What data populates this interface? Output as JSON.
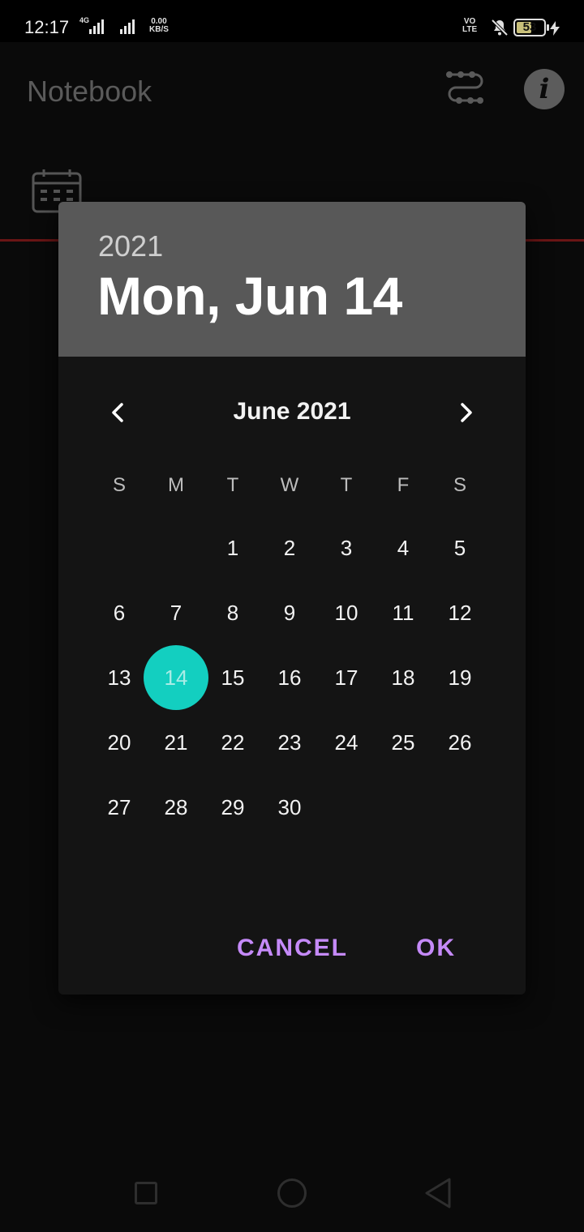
{
  "status_bar": {
    "time": "12:17",
    "network": "4G",
    "speed_value": "0.00",
    "speed_unit": "KB/S",
    "volte_top": "VO",
    "volte_bottom": "LTE",
    "battery": "53"
  },
  "app_bar": {
    "title": "Notebook",
    "filter_icon": "filter-flow-icon",
    "info_icon": "info-icon",
    "info_glyph": "i"
  },
  "dialog": {
    "year": "2021",
    "selected_date": "Mon, Jun 14",
    "month_label": "June 2021",
    "weekdays": [
      "S",
      "M",
      "T",
      "W",
      "T",
      "F",
      "S"
    ],
    "weeks": [
      [
        "",
        "",
        "1",
        "2",
        "3",
        "4",
        "5"
      ],
      [
        "6",
        "7",
        "8",
        "9",
        "10",
        "11",
        "12"
      ],
      [
        "13",
        "14",
        "15",
        "16",
        "17",
        "18",
        "19"
      ],
      [
        "20",
        "21",
        "22",
        "23",
        "24",
        "25",
        "26"
      ],
      [
        "27",
        "28",
        "29",
        "30",
        "",
        "",
        ""
      ]
    ],
    "selected_day": "14",
    "cancel_label": "CANCEL",
    "ok_label": "OK",
    "accent_color": "#c58af9",
    "selection_color": "#13cfc0"
  }
}
